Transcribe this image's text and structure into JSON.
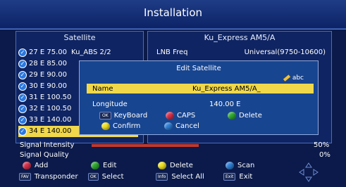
{
  "header": {
    "title": "Installation"
  },
  "left_panel": {
    "title": "Satellite",
    "items": [
      {
        "label": "27 E 75.00",
        "name": "Ku_ABS 2/2"
      },
      {
        "label": "28 E 85.00",
        "name": ""
      },
      {
        "label": "29 E 90.00",
        "name": ""
      },
      {
        "label": "30 E 90.00",
        "name": ""
      },
      {
        "label": "31 E 100.50",
        "name": ""
      },
      {
        "label": "32 E 100.50",
        "name": ""
      },
      {
        "label": "33 E 140.00",
        "name": ""
      },
      {
        "label": "34 E 140.00",
        "name": "",
        "selected": true
      }
    ]
  },
  "right_panel": {
    "title": "Ku_Express AM5/A",
    "lnb_label": "LNB Freq",
    "lnb_value": "Universal(9750-10600)"
  },
  "dialog": {
    "title": "Edit Satellite",
    "ime_mode": "abc",
    "name_label": "Name",
    "name_value": "Ku_Express AM5/A_",
    "longitude_label": "Longitude",
    "longitude_value": "140.00 E",
    "ok_key": "OK",
    "keyboard_label": "KeyBoard",
    "caps_label": "CAPS",
    "delete_label": "Delete",
    "confirm_label": "Confirm",
    "cancel_label": "Cancel"
  },
  "signal": {
    "intensity_label": "Signal Intensity",
    "intensity_value": "50%",
    "intensity_fraction": 0.5,
    "quality_label": "Signal Quality",
    "quality_value": "0%"
  },
  "legend": {
    "add": "Add",
    "edit": "Edit",
    "delete": "Delete",
    "scan": "Scan",
    "fav_key": "FAV",
    "transponder": "Transponder",
    "ok_key": "OK",
    "select": "Select",
    "info_key": "Info",
    "select_all": "Select All",
    "exit_key": "Exit",
    "exit": "Exit"
  },
  "colors": {
    "background": "#0b1a4a",
    "highlight": "#f0d84a",
    "red": "#d6304a",
    "green": "#2ea82e",
    "yellow": "#f0e020",
    "blue": "#2e7fd6"
  }
}
